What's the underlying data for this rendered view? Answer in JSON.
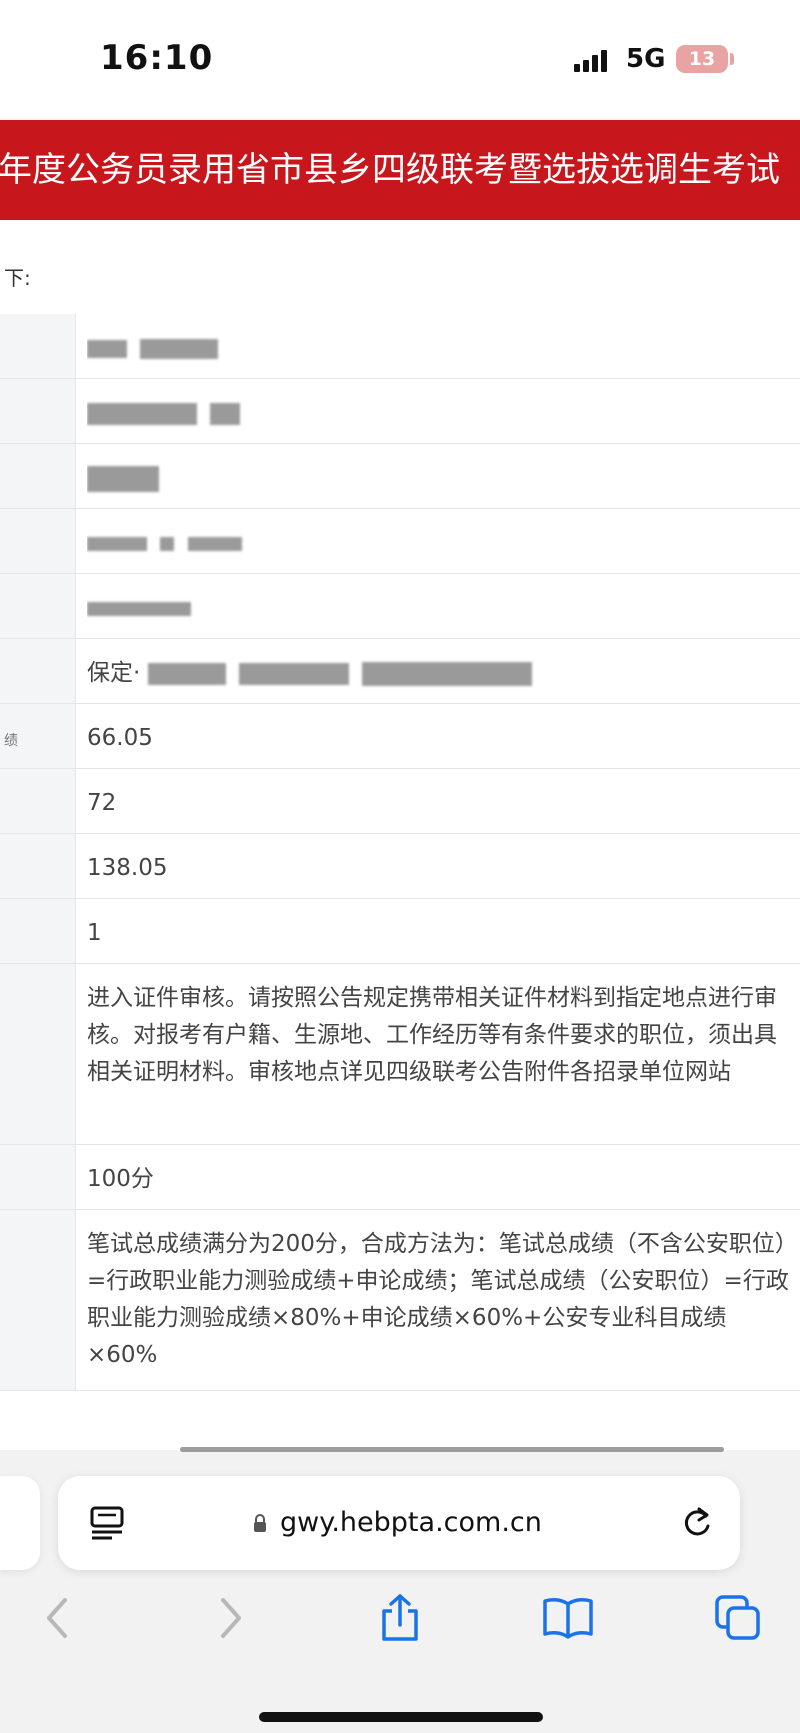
{
  "status_bar": {
    "time": "16:10",
    "network": "5G",
    "battery": "13"
  },
  "banner": {
    "title": "年度公务员录用省市县乡四级联考暨选拔选调生考试"
  },
  "page": {
    "intro": "下:",
    "rows": [
      {
        "label": "",
        "value": "",
        "redacted": true
      },
      {
        "label": "",
        "value": "",
        "redacted": true
      },
      {
        "label": "",
        "value": "",
        "redacted": true
      },
      {
        "label": "",
        "value": "",
        "redacted": true
      },
      {
        "label": "",
        "value": "",
        "redacted": true
      },
      {
        "label": "",
        "value": "保定·",
        "redacted": true
      },
      {
        "label": "绩",
        "value": "66.05"
      },
      {
        "label": "",
        "value": "72"
      },
      {
        "label": "",
        "value": "138.05"
      },
      {
        "label": "",
        "value": "1"
      },
      {
        "label": "",
        "value": "进入证件审核。请按照公告规定携带相关证件材料到指定地点进行审核。对报考有户籍、生源地、工作经历等有条件要求的职位，须出具相关证明材料。审核地点详见四级联考公告附件各招录单位网站"
      },
      {
        "label": "",
        "value": "100分"
      },
      {
        "label": "",
        "value": "笔试总成绩满分为200分，合成方法为：笔试总成绩（不含公安职位）=行政职业能力测验成绩+申论成绩；笔试总成绩（公安职位）=行政职业能力测验成绩×80%+申论成绩×60%+公安专业科目成绩×60%"
      }
    ]
  },
  "browser": {
    "url": "gwy.hebpta.com.cn",
    "icons": [
      "reader-mode-icon",
      "lock-icon",
      "reload-icon",
      "back-icon",
      "forward-icon",
      "share-icon",
      "bookmarks-icon",
      "tabs-icon"
    ]
  },
  "colors": {
    "banner": "#c8161d",
    "accent": "#1a73e8"
  }
}
